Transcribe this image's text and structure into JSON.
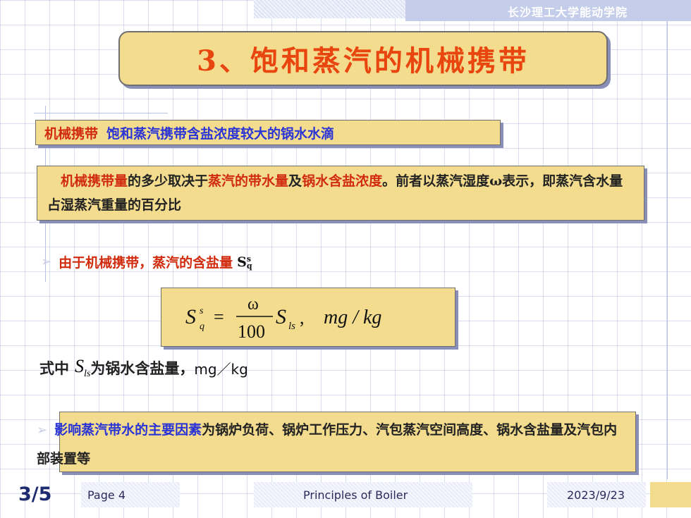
{
  "header": {
    "institution": "长沙理工大学能动学院"
  },
  "title": "3、饱和蒸汽的机械携带",
  "definition": {
    "term": "机械携带",
    "text": "饱和蒸汽携带含盐浓度较大的锅水水滴"
  },
  "paragraph": {
    "p1": "机械携带量",
    "p2": "的多少取决于",
    "p3": "蒸汽的带水量",
    "p4": "及",
    "p5": "锅水含盐浓度",
    "p6": "。前者以蒸汽湿度ω表示，即蒸汽含水量占湿蒸汽重量的百分比"
  },
  "bullet1": {
    "text": "由于机械携带，蒸汽的含盐量",
    "symbol": "S",
    "sup": "s",
    "sub": "q"
  },
  "formula": {
    "lhs": "S",
    "lhs_sup": "s",
    "lhs_sub": "q",
    "numerator": "ω",
    "denominator": "100",
    "rhs": "S",
    "rhs_sub": "ls",
    "unit": "mg / kg"
  },
  "where": {
    "prefix": "式中",
    "symbol": "S",
    "sub": "ls",
    "text": "为锅水含盐量，",
    "unit": "mg／kg"
  },
  "factors": {
    "highlight": "影响蒸汽带水的主要因素",
    "rest": "为锅炉负荷、锅炉工作压力、汽包蒸汽空间高度、锅水含盐量及汽包内部装置等"
  },
  "footer": {
    "slide_progress": "3/5",
    "page": "Page 4",
    "course": "Principles of Boiler",
    "date": "2023/9/23"
  }
}
